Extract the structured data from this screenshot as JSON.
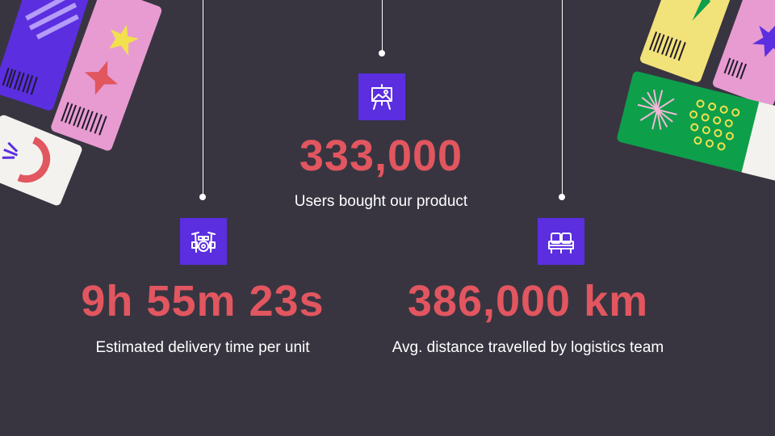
{
  "stats": [
    {
      "value": "333,000",
      "label": "Users bought our product",
      "icon": "easel-icon"
    },
    {
      "value": "9h 55m 23s",
      "label": "Estimated delivery time per unit",
      "icon": "drum-kit-icon"
    },
    {
      "value": "386,000 km",
      "label": "Avg. distance travelled by logistics team",
      "icon": "seats-icon"
    }
  ],
  "colors": {
    "background": "#383541",
    "accent": "#e2565f",
    "icon_bg": "#5b2ee0",
    "text": "#ffffff"
  }
}
